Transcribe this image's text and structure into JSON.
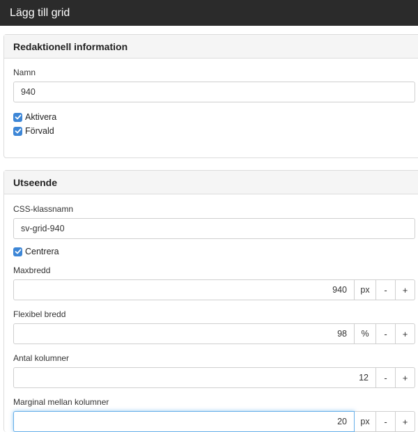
{
  "dialog": {
    "title": "Lägg till grid"
  },
  "editorial": {
    "heading": "Redaktionell information",
    "name_label": "Namn",
    "name_value": "940",
    "activate_label": "Aktivera",
    "default_label": "Förvald"
  },
  "appearance": {
    "heading": "Utseende",
    "css_label": "CSS-klassnamn",
    "css_value": "sv-grid-940",
    "center_label": "Centrera",
    "max_width": {
      "label": "Maxbredd",
      "value": "940",
      "unit": "px"
    },
    "flex_width": {
      "label": "Flexibel bredd",
      "value": "98",
      "unit": "%"
    },
    "columns": {
      "label": "Antal kolumner",
      "value": "12"
    },
    "gutter": {
      "label": "Marginal mellan kolumner",
      "value": "20",
      "unit": "px"
    },
    "decrement_label": "-",
    "increment_label": "+"
  },
  "colors": {
    "titlebar": "#2b2b2b",
    "checkbox": "#3d86d6",
    "focus": "#66afe9"
  }
}
